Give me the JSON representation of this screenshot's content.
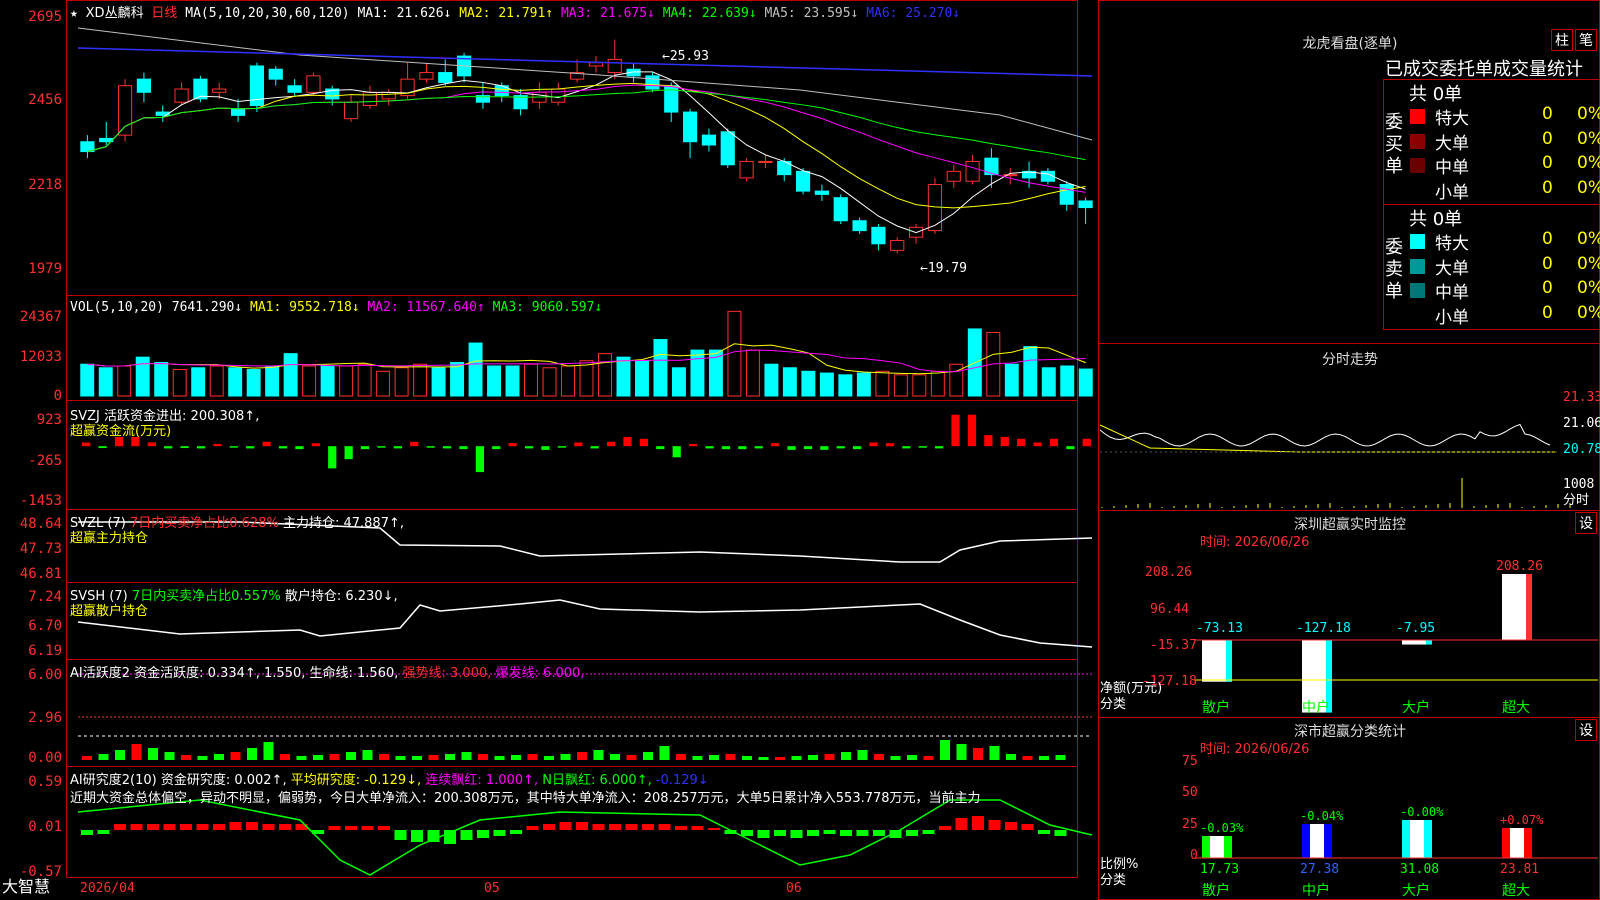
{
  "header": {
    "star": "★",
    "stock": "XD丛麟科",
    "period": "日线",
    "ma_label": "MA(5,10,20,30,60,120)",
    "ma1": "MA1: 21.626↓",
    "ma2": "MA2: 21.791↑",
    "ma3": "MA3: 21.675↓",
    "ma4": "MA4: 22.639↓",
    "ma5": "MA5: 23.595↓",
    "ma6": "MA6: 25.270↓",
    "high_marker": "25.93",
    "low_marker": "19.79"
  },
  "y_axes": {
    "main": [
      "2695",
      "2456",
      "2218",
      "1979"
    ],
    "vol": [
      "24367",
      "12033",
      "0"
    ],
    "svzj": [
      "923",
      "-265",
      "-1453"
    ],
    "svzl": [
      "48.64",
      "47.73",
      "46.81"
    ],
    "svsh": [
      "7.24",
      "6.70",
      "6.19"
    ],
    "ai1": [
      "6.00",
      "2.96",
      "0.00"
    ],
    "ai2": [
      "0.59",
      "0.01",
      "-0.57"
    ]
  },
  "indicators": {
    "vol_label": "VOL(5,10,20)",
    "vol_value": "7641.290↓",
    "vol_ma1": "MA1: 9552.718↓",
    "vol_ma2": "MA2: 11567.640↑",
    "vol_ma3": "MA3: 9060.597↓",
    "svzj_name": "SVZJ",
    "svzj_value": "活跃资金进出: 200.308↑,",
    "svzj_sub": "超赢资金流(万元)",
    "svzl_name": "SVZL (7)",
    "svzl_ratio": "7日内买卖净占比0.628%",
    "svzl_value": "主力持仓: 47.887↑,",
    "svzl_sub": "超赢主力持仓",
    "svsh_name": "SVSH (7)",
    "svsh_ratio": "7日内买卖净占比0.557%",
    "svsh_value": "散户持仓: 6.230↓,",
    "svsh_sub": "超赢散户持仓",
    "ai1_name": "AI活跃度2",
    "ai1_value": "资金活跃度: 0.334↑, 1.550, 生命线: 1.560,",
    "ai1_strong": "强势线: 3.000,",
    "ai1_burst": "爆发线: 6.000,",
    "ai2_name": "AI研究度2(10)",
    "ai2_value": "资金研究度: 0.002↑,",
    "ai2_avg": "平均研究度: -0.129↓,",
    "ai2_cont": "连续飘红: 1.000↑,",
    "ai2_n": "N日飘红: 6.000↑,",
    "ai2_last": "-0.129↓",
    "ai2_text": "近期大资金总体偏空，异动不明显，偏弱势，今日大单净流入：200.308万元，其中特大单净流入：208.257万元，大单5日累计净入553.778万元，当前主力"
  },
  "x_axis": {
    "brand": "大智慧",
    "date1": "2026/04",
    "date2": "05",
    "date3": "06"
  },
  "right": {
    "lhb_title": "龙虎看盘(逐单)",
    "btn1": "柱",
    "btn2": "笔",
    "stat_title": "已成交委托单成交量统计",
    "buy_label": "委买单",
    "sell_label": "委卖单",
    "buy_total": "共 0单",
    "sell_total": "共 0单",
    "buy_rows": [
      {
        "name": "特大",
        "count": "0",
        "pct": "0%",
        "color": "#ff0000"
      },
      {
        "name": "大单",
        "count": "0",
        "pct": "0%",
        "color": "#8b0000"
      },
      {
        "name": "中单",
        "count": "0",
        "pct": "0%",
        "color": "#6b0000"
      },
      {
        "name": "小单",
        "count": "0",
        "pct": "0%",
        "color": ""
      }
    ],
    "sell_rows": [
      {
        "name": "特大",
        "count": "0",
        "pct": "0%",
        "color": "#00ffff"
      },
      {
        "name": "大单",
        "count": "0",
        "pct": "0%",
        "color": "#009999"
      },
      {
        "name": "中单",
        "count": "0",
        "pct": "0%",
        "color": "#007777"
      },
      {
        "name": "小单",
        "count": "0",
        "pct": "0%",
        "color": ""
      }
    ],
    "fs_title": "分时走势",
    "fs_y": [
      "21.33",
      "21.06",
      "20.78"
    ],
    "fs_vol": "1008",
    "fs_unit": "分时",
    "sz_title": "深圳超赢实时监控",
    "sz_btn": "设",
    "sz_time": "时间: 2026/06/26",
    "sz_y": [
      "208.26",
      "96.44",
      "-15.37",
      "-127.18"
    ],
    "sz_ylabel1": "净额(万元)",
    "sz_ylabel2": "分类",
    "ss_title": "深市超赢分类统计",
    "ss_btn": "设",
    "ss_time": "时间: 2026/06/26",
    "ss_y": [
      "75",
      "50",
      "25",
      "0"
    ],
    "ss_ylabel1": "比例%",
    "ss_ylabel2": "分类"
  },
  "chart_data": [
    {
      "type": "candlestick",
      "title": "XD丛麟科 日线",
      "ylim": [
        1900,
        2720
      ],
      "note": "prices shown x100 on axis",
      "candles": [
        {
          "o": 2320,
          "c": 2290,
          "h": 2340,
          "l": 2270
        },
        {
          "o": 2330,
          "c": 2320,
          "h": 2380,
          "l": 2310
        },
        {
          "o": 2340,
          "c": 2490,
          "h": 2510,
          "l": 2320
        },
        {
          "o": 2510,
          "c": 2470,
          "h": 2530,
          "l": 2440
        },
        {
          "o": 2410,
          "c": 2400,
          "h": 2430,
          "l": 2380
        },
        {
          "o": 2440,
          "c": 2480,
          "h": 2500,
          "l": 2430
        },
        {
          "o": 2510,
          "c": 2450,
          "h": 2520,
          "l": 2440
        },
        {
          "o": 2470,
          "c": 2480,
          "h": 2500,
          "l": 2450
        },
        {
          "o": 2420,
          "c": 2400,
          "h": 2450,
          "l": 2380
        },
        {
          "o": 2550,
          "c": 2430,
          "h": 2560,
          "l": 2410
        },
        {
          "o": 2540,
          "c": 2510,
          "h": 2550,
          "l": 2490
        },
        {
          "o": 2490,
          "c": 2470,
          "h": 2510,
          "l": 2460
        },
        {
          "o": 2470,
          "c": 2520,
          "h": 2530,
          "l": 2460
        },
        {
          "o": 2480,
          "c": 2450,
          "h": 2490,
          "l": 2430
        },
        {
          "o": 2390,
          "c": 2440,
          "h": 2460,
          "l": 2380
        },
        {
          "o": 2430,
          "c": 2470,
          "h": 2490,
          "l": 2420
        },
        {
          "o": 2450,
          "c": 2470,
          "h": 2480,
          "l": 2430
        },
        {
          "o": 2460,
          "c": 2510,
          "h": 2560,
          "l": 2450
        },
        {
          "o": 2510,
          "c": 2530,
          "h": 2560,
          "l": 2500
        },
        {
          "o": 2530,
          "c": 2500,
          "h": 2570,
          "l": 2490
        },
        {
          "o": 2580,
          "c": 2520,
          "h": 2590,
          "l": 2500
        },
        {
          "o": 2460,
          "c": 2440,
          "h": 2500,
          "l": 2420
        },
        {
          "o": 2490,
          "c": 2460,
          "h": 2500,
          "l": 2440
        },
        {
          "o": 2460,
          "c": 2420,
          "h": 2480,
          "l": 2400
        },
        {
          "o": 2440,
          "c": 2470,
          "h": 2500,
          "l": 2420
        },
        {
          "o": 2440,
          "c": 2480,
          "h": 2500,
          "l": 2430
        },
        {
          "o": 2510,
          "c": 2530,
          "h": 2570,
          "l": 2500
        },
        {
          "o": 2550,
          "c": 2560,
          "h": 2580,
          "l": 2530
        },
        {
          "o": 2530,
          "c": 2570,
          "h": 2630,
          "l": 2510
        },
        {
          "o": 2540,
          "c": 2520,
          "h": 2560,
          "l": 2500
        },
        {
          "o": 2520,
          "c": 2480,
          "h": 2530,
          "l": 2470
        },
        {
          "o": 2490,
          "c": 2410,
          "h": 2500,
          "l": 2380
        },
        {
          "o": 2410,
          "c": 2320,
          "h": 2420,
          "l": 2270
        },
        {
          "o": 2340,
          "c": 2310,
          "h": 2360,
          "l": 2290
        },
        {
          "o": 2350,
          "c": 2250,
          "h": 2360,
          "l": 2240
        },
        {
          "o": 2210,
          "c": 2260,
          "h": 2270,
          "l": 2200
        },
        {
          "o": 2260,
          "c": 2260,
          "h": 2280,
          "l": 2240
        },
        {
          "o": 2260,
          "c": 2220,
          "h": 2270,
          "l": 2200
        },
        {
          "o": 2230,
          "c": 2170,
          "h": 2240,
          "l": 2160
        },
        {
          "o": 2170,
          "c": 2160,
          "h": 2190,
          "l": 2140
        },
        {
          "o": 2150,
          "c": 2080,
          "h": 2160,
          "l": 2070
        },
        {
          "o": 2080,
          "c": 2050,
          "h": 2090,
          "l": 2040
        },
        {
          "o": 2060,
          "c": 2010,
          "h": 2070,
          "l": 1990
        },
        {
          "o": 1990,
          "c": 2020,
          "h": 2030,
          "l": 1980
        },
        {
          "o": 2030,
          "c": 2060,
          "h": 2070,
          "l": 2010
        },
        {
          "o": 2050,
          "c": 2190,
          "h": 2210,
          "l": 2040
        },
        {
          "o": 2200,
          "c": 2230,
          "h": 2250,
          "l": 2180
        },
        {
          "o": 2200,
          "c": 2260,
          "h": 2280,
          "l": 2190
        },
        {
          "o": 2270,
          "c": 2220,
          "h": 2300,
          "l": 2180
        },
        {
          "o": 2220,
          "c": 2220,
          "h": 2240,
          "l": 2190
        },
        {
          "o": 2230,
          "c": 2210,
          "h": 2260,
          "l": 2180
        },
        {
          "o": 2230,
          "c": 2200,
          "h": 2240,
          "l": 2190
        },
        {
          "o": 2190,
          "c": 2130,
          "h": 2200,
          "l": 2110
        },
        {
          "o": 2140,
          "c": 2120,
          "h": 2150,
          "l": 2070
        }
      ]
    },
    {
      "type": "bar",
      "title": "VOL(5,10,20)",
      "ylim": [
        0,
        24367
      ],
      "values": [
        9000,
        8000,
        8500,
        11000,
        9500,
        7500,
        8000,
        8500,
        8000,
        7500,
        8500,
        12000,
        8500,
        8500,
        8500,
        9000,
        7000,
        8000,
        9000,
        8000,
        9500,
        15000,
        8500,
        8500,
        9000,
        8000,
        8500,
        10000,
        12000,
        11000,
        10000,
        16000,
        8000,
        13000,
        13000,
        24000,
        13000,
        9000,
        8000,
        7000,
        6500,
        6000,
        6500,
        7000,
        6000,
        6000,
        7000,
        9000,
        19000,
        18000,
        9000,
        14000,
        8000,
        8500,
        7641
      ]
    },
    {
      "type": "bar",
      "title": "SVZJ",
      "ylim": [
        -1453,
        923
      ],
      "values": [
        100,
        -50,
        250,
        250,
        100,
        -60,
        -50,
        -60,
        60,
        -40,
        -60,
        120,
        -60,
        -80,
        80,
        -600,
        -350,
        -80,
        -40,
        -60,
        120,
        -40,
        -60,
        -80,
        -700,
        -80,
        80,
        -60,
        -100,
        -40,
        100,
        -60,
        120,
        250,
        200,
        -80,
        -300,
        60,
        -60,
        -80,
        -80,
        -60,
        80,
        -100,
        -80,
        -100,
        -60,
        -80,
        100,
        80,
        -60,
        -40,
        -60,
        850,
        850,
        300,
        250,
        200,
        100,
        200,
        -80,
        200
      ]
    }
  ]
}
